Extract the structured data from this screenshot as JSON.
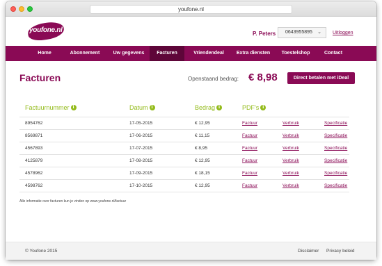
{
  "browser": {
    "url": "youfone.nl"
  },
  "header": {
    "logo_text": "youfone.nl",
    "user_name": "P. Peters",
    "phone_number": "0643955895",
    "logout_label": "Uitloggen"
  },
  "nav": {
    "items": [
      {
        "label": "Home"
      },
      {
        "label": "Abonnement"
      },
      {
        "label": "Uw gegevens"
      },
      {
        "label": "Facturen"
      },
      {
        "label": "Vriendendeal"
      },
      {
        "label": "Extra diensten"
      },
      {
        "label": "Toestelshop"
      },
      {
        "label": "Contact"
      }
    ],
    "active": "Facturen"
  },
  "main": {
    "title": "Facturen",
    "outstanding_label": "Openstaand bedrag:",
    "outstanding_amount": "€ 8,98",
    "pay_button": "Direct betalen met iDeal",
    "columns": [
      "Factuurnummer",
      "Datum",
      "Bedrag",
      "PDF's"
    ],
    "rows": [
      {
        "number": "8954762",
        "date": "17-05-2015",
        "amount": "€ 12,95",
        "factuur": "Factuur",
        "verbruik": "Verbruik",
        "specificatie": "Specificatie"
      },
      {
        "number": "8569871",
        "date": "17-06-2015",
        "amount": "€ 11,15",
        "factuur": "Factuur",
        "verbruik": "Verbruik",
        "specificatie": "Specificatie"
      },
      {
        "number": "4567893",
        "date": "17-07-2015",
        "amount": "€ 8,95",
        "factuur": "Factuur",
        "verbruik": "Verbruik",
        "specificatie": "Specificatie"
      },
      {
        "number": "4125879",
        "date": "17-08-2015",
        "amount": "€ 12,95",
        "factuur": "Factuur",
        "verbruik": "Verbruik",
        "specificatie": "Specificatie"
      },
      {
        "number": "4578962",
        "date": "17-09-2015",
        "amount": "€ 18,15",
        "factuur": "Factuur",
        "verbruik": "Verbruik",
        "specificatie": "Specificatie"
      },
      {
        "number": "4598762",
        "date": "17-10-2015",
        "amount": "€ 12,95",
        "factuur": "Factuur",
        "verbruik": "Verbruik",
        "specificatie": "Specificatie"
      }
    ],
    "footnote": "Alle informatie over facturen kun je vinden op www.youfone.nl/factuur"
  },
  "footer": {
    "copyright": "© Youfone 2015",
    "disclaimer": "Disclaimer",
    "privacy": "Privacy beleid"
  },
  "colors": {
    "brand": "#8a0a55",
    "accent_green": "#93bb1a",
    "nav_active": "#5e0639"
  },
  "icons": {
    "info": "info-icon",
    "dropdown": "chevron-down-icon"
  }
}
